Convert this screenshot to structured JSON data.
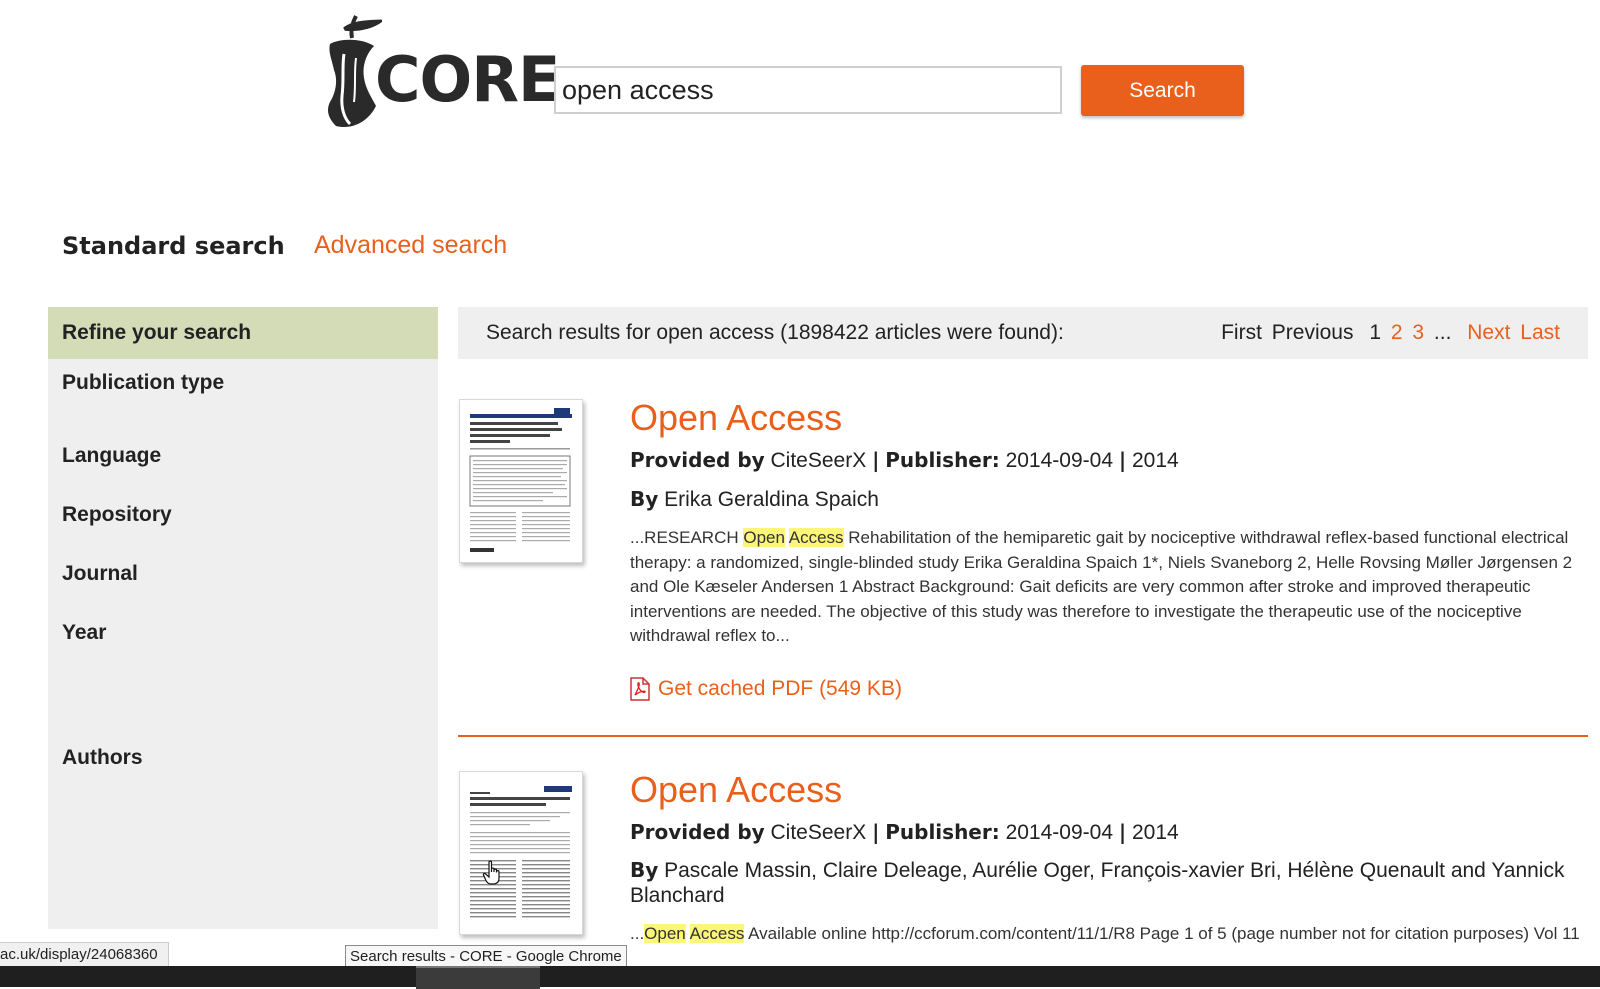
{
  "header": {
    "logo_text": "CORE",
    "search_value": "open access",
    "search_button_label": "Search"
  },
  "mode_tabs": {
    "standard": "Standard search",
    "advanced": "Advanced search"
  },
  "sidebar": {
    "title": "Refine your search",
    "facets": [
      "Publication type",
      "Language",
      "Repository",
      "Journal",
      "Year",
      "Authors"
    ]
  },
  "results_bar": {
    "summary": "Search results for open access (1898422 articles were found):",
    "first": "First",
    "previous": "Previous",
    "current_page": "1",
    "page_2": "2",
    "page_3": "3",
    "ellipsis": "...",
    "next": "Next",
    "last": "Last"
  },
  "results": [
    {
      "title": "Open Access",
      "provided_by_label": "Provided by",
      "provider": "CiteSeerX",
      "sep1": "|",
      "publisher_label": "Publisher:",
      "publisher": "2014-09-04",
      "sep2": "|",
      "year": "2014",
      "by_label": "By",
      "authors": "Erika Geraldina Spaich",
      "snippet_pre": "...RESEARCH ",
      "snippet_hl1": "Open",
      "snippet_hl2": "Access",
      "snippet_post": " Rehabilitation of the hemiparetic gait by nociceptive withdrawal reflex-based functional electrical therapy: a randomized, single-blinded study Erika Geraldina Spaich 1*, Niels Svaneborg 2, Helle Rovsing Møller Jørgensen 2 and Ole Kæseler Andersen 1 Abstract Background: Gait deficits are very common after stroke and improved therapeutic interventions are needed. The objective of this study was therefore to investigate the therapeutic use of the nociceptive withdrawal reflex to...",
      "pdf_link": "Get cached PDF (549 KB)"
    },
    {
      "title": "Open Access",
      "provided_by_label": "Provided by",
      "provider": "CiteSeerX",
      "sep1": "|",
      "publisher_label": "Publisher:",
      "publisher": "2014-09-04",
      "sep2": "|",
      "year": "2014",
      "by_label": "By",
      "authors": "Pascale Massin, Claire Deleage, Aurélie Oger, François-xavier Bri, Hélène Quenault and Yannick Blanchard",
      "snippet_pre": "...",
      "snippet_hl1": "Open",
      "snippet_hl2": "Access",
      "snippet_post": " Available online http://ccforum.com/content/11/1/R8 Page 1 of 5 (page number not for citation purposes) Vol 11"
    }
  ],
  "status_bar": {
    "url": "ac.uk/display/24068360",
    "tooltip": "Search results - CORE - Google Chrome"
  },
  "colors": {
    "accent": "#e8601c",
    "sidebar_header": "#d3dbb7",
    "panel_bg": "#efefef",
    "highlight": "#fbf67a"
  },
  "icons": [
    "apple-core-logo-icon",
    "pdf-icon",
    "hand-cursor-icon"
  ]
}
